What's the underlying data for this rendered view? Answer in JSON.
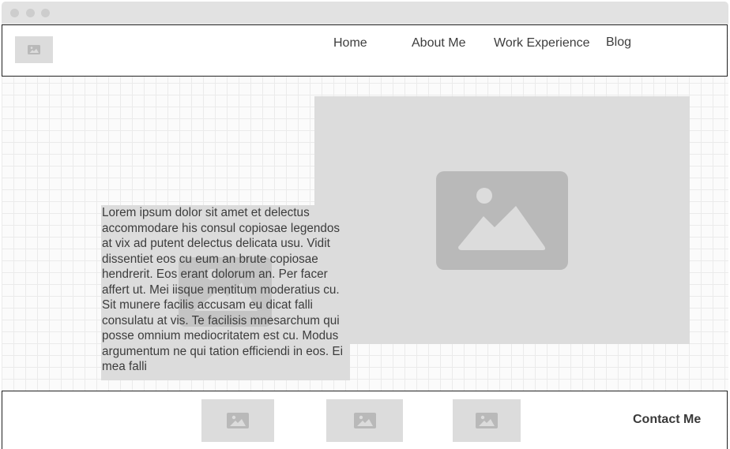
{
  "nav": {
    "home": "Home",
    "about": "About Me",
    "work": "Work Experience",
    "blog": "Blog"
  },
  "main": {
    "lorem": "Lorem ipsum dolor sit amet et delectus accommodare his consul copiosae legendos at vix ad putent delectus delicata usu. Vidit dissentiet eos cu eum an brute copiosae hendrerit. Eos erant dolorum an. Per facer affert ut. Mei iisque mentitum moderatius cu. Sit munere facilis accusam eu dicat falli consulatu at vis. Te facilisis mnesarchum qui posse omnium mediocritatem est cu. Modus argumentum ne qui tation efficiendi in eos. Ei mea falli"
  },
  "footer": {
    "contact": "Contact Me"
  },
  "icons": {
    "logo": "image-icon",
    "hero": "image-icon",
    "footer_images": [
      "image-icon",
      "image-icon",
      "image-icon"
    ]
  },
  "colors": {
    "placeholder_fill": "#dcdcdc",
    "placeholder_icon": "#b9b9b9",
    "grid_line": "#ebebeb",
    "text": "#3a3a3a"
  }
}
